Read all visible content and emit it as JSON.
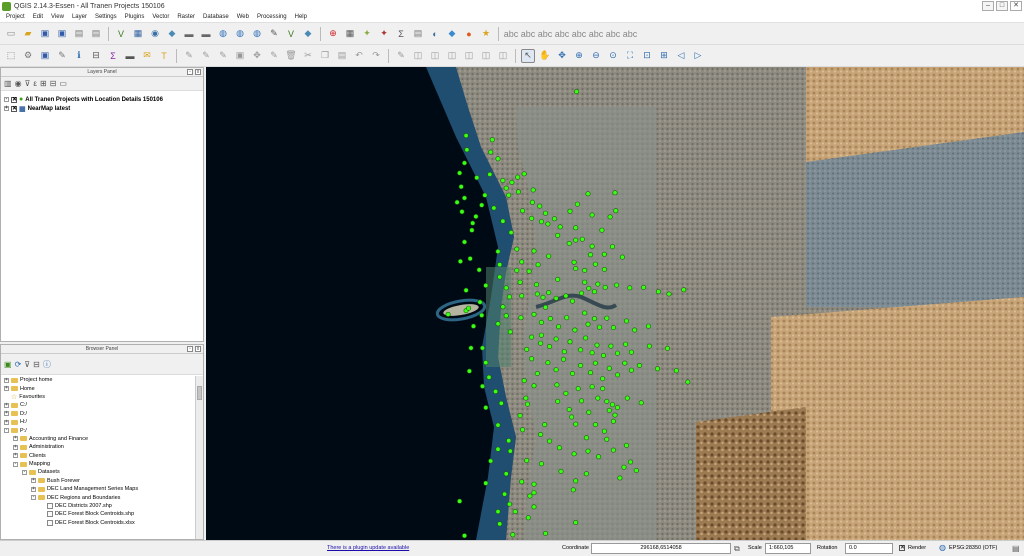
{
  "window": {
    "title": "QGIS 2.14.3-Essen - All Tranen Projects 150106"
  },
  "menu": [
    "Project",
    "Edit",
    "View",
    "Layer",
    "Settings",
    "Plugins",
    "Vector",
    "Raster",
    "Database",
    "Web",
    "Processing",
    "Help"
  ],
  "layers_panel": {
    "title": "Layers Panel",
    "layers": [
      {
        "name": "All Tranen Projects with Location Details 150106",
        "checked": true
      },
      {
        "name": "NearMap latest",
        "checked": true
      }
    ]
  },
  "browser_panel": {
    "title": "Browser Panel",
    "items": [
      {
        "label": "Project home",
        "kind": "folder",
        "depth": 0,
        "expander": "+"
      },
      {
        "label": "Home",
        "kind": "folder",
        "depth": 0,
        "expander": "+"
      },
      {
        "label": "Favourites",
        "kind": "star",
        "depth": 0,
        "expander": ""
      },
      {
        "label": "C:/",
        "kind": "folder",
        "depth": 0,
        "expander": "+"
      },
      {
        "label": "D:/",
        "kind": "folder",
        "depth": 0,
        "expander": "+"
      },
      {
        "label": "H:/",
        "kind": "folder",
        "depth": 0,
        "expander": "+"
      },
      {
        "label": "P:/",
        "kind": "folder",
        "depth": 0,
        "expander": "-"
      },
      {
        "label": "Accounting and Finance",
        "kind": "folder",
        "depth": 1,
        "expander": "+"
      },
      {
        "label": "Administration",
        "kind": "folder",
        "depth": 1,
        "expander": "+"
      },
      {
        "label": "Clients",
        "kind": "folder",
        "depth": 1,
        "expander": "+"
      },
      {
        "label": "Mapping",
        "kind": "folder",
        "depth": 1,
        "expander": "-"
      },
      {
        "label": "Datasets",
        "kind": "folder",
        "depth": 2,
        "expander": "-"
      },
      {
        "label": "Bush Forever",
        "kind": "folder",
        "depth": 3,
        "expander": "+"
      },
      {
        "label": "DEC Land Management Series Maps",
        "kind": "folder",
        "depth": 3,
        "expander": "+"
      },
      {
        "label": "DEC Regions and Boundaries",
        "kind": "folder",
        "depth": 3,
        "expander": "-"
      },
      {
        "label": "DEC Districts 2007.shp",
        "kind": "file",
        "depth": 4,
        "expander": ""
      },
      {
        "label": "DEC Forest Block Centroids.shp",
        "kind": "file",
        "depth": 4,
        "expander": ""
      },
      {
        "label": "DEC Forest Block Centroids.xlsx",
        "kind": "file",
        "depth": 4,
        "expander": ""
      }
    ]
  },
  "status": {
    "update_link": "There is a plugin update available",
    "coordinate_label": "Coordinate",
    "coordinate_value": "296168,6514058",
    "scale_label": "Scale",
    "scale_value": "1:660,105",
    "rotation_label": "Rotation",
    "rotation_value": "0.0",
    "render_label": "Render",
    "crs": "EPSG:28350 (OTF)"
  },
  "colors": {
    "point": "#39ff14",
    "point_outline": "#1a5c0a",
    "sea": "#000a14"
  },
  "map_points": [
    [
      0.453,
      0.052
    ],
    [
      0.35,
      0.154
    ],
    [
      0.348,
      0.18
    ],
    [
      0.357,
      0.194
    ],
    [
      0.363,
      0.24
    ],
    [
      0.367,
      0.256
    ],
    [
      0.37,
      0.271
    ],
    [
      0.374,
      0.244
    ],
    [
      0.381,
      0.233
    ],
    [
      0.389,
      0.226
    ],
    [
      0.382,
      0.264
    ],
    [
      0.399,
      0.286
    ],
    [
      0.408,
      0.294
    ],
    [
      0.415,
      0.309
    ],
    [
      0.41,
      0.327
    ],
    [
      0.418,
      0.332
    ],
    [
      0.426,
      0.321
    ],
    [
      0.433,
      0.338
    ],
    [
      0.43,
      0.356
    ],
    [
      0.444,
      0.373
    ],
    [
      0.452,
      0.366
    ],
    [
      0.46,
      0.364
    ],
    [
      0.484,
      0.345
    ],
    [
      0.472,
      0.379
    ],
    [
      0.47,
      0.397
    ],
    [
      0.476,
      0.417
    ],
    [
      0.43,
      0.449
    ],
    [
      0.404,
      0.46
    ],
    [
      0.405,
      0.48
    ],
    [
      0.412,
      0.487
    ],
    [
      0.419,
      0.477
    ],
    [
      0.428,
      0.489
    ],
    [
      0.44,
      0.484
    ],
    [
      0.448,
      0.495
    ],
    [
      0.459,
      0.478
    ],
    [
      0.463,
      0.455
    ],
    [
      0.468,
      0.468
    ],
    [
      0.479,
      0.459
    ],
    [
      0.475,
      0.475
    ],
    [
      0.488,
      0.466
    ],
    [
      0.502,
      0.461
    ],
    [
      0.518,
      0.467
    ],
    [
      0.535,
      0.466
    ],
    [
      0.553,
      0.475
    ],
    [
      0.566,
      0.48
    ],
    [
      0.584,
      0.471
    ],
    [
      0.415,
      0.508
    ],
    [
      0.401,
      0.523
    ],
    [
      0.41,
      0.54
    ],
    [
      0.421,
      0.532
    ],
    [
      0.431,
      0.549
    ],
    [
      0.441,
      0.53
    ],
    [
      0.451,
      0.556
    ],
    [
      0.463,
      0.52
    ],
    [
      0.467,
      0.544
    ],
    [
      0.475,
      0.532
    ],
    [
      0.481,
      0.55
    ],
    [
      0.49,
      0.531
    ],
    [
      0.498,
      0.551
    ],
    [
      0.514,
      0.537
    ],
    [
      0.524,
      0.556
    ],
    [
      0.541,
      0.548
    ],
    [
      0.398,
      0.571
    ],
    [
      0.409,
      0.584
    ],
    [
      0.42,
      0.591
    ],
    [
      0.428,
      0.575
    ],
    [
      0.438,
      0.602
    ],
    [
      0.445,
      0.581
    ],
    [
      0.458,
      0.598
    ],
    [
      0.464,
      0.573
    ],
    [
      0.472,
      0.604
    ],
    [
      0.478,
      0.588
    ],
    [
      0.486,
      0.61
    ],
    [
      0.495,
      0.59
    ],
    [
      0.503,
      0.605
    ],
    [
      0.513,
      0.586
    ],
    [
      0.52,
      0.603
    ],
    [
      0.542,
      0.59
    ],
    [
      0.564,
      0.595
    ],
    [
      0.418,
      0.625
    ],
    [
      0.428,
      0.64
    ],
    [
      0.437,
      0.618
    ],
    [
      0.448,
      0.648
    ],
    [
      0.458,
      0.631
    ],
    [
      0.47,
      0.646
    ],
    [
      0.476,
      0.626
    ],
    [
      0.485,
      0.659
    ],
    [
      0.493,
      0.637
    ],
    [
      0.503,
      0.651
    ],
    [
      0.52,
      0.641
    ],
    [
      0.512,
      0.626
    ],
    [
      0.53,
      0.631
    ],
    [
      0.552,
      0.638
    ],
    [
      0.575,
      0.642
    ],
    [
      0.589,
      0.666
    ],
    [
      0.429,
      0.672
    ],
    [
      0.44,
      0.69
    ],
    [
      0.455,
      0.68
    ],
    [
      0.472,
      0.676
    ],
    [
      0.479,
      0.7
    ],
    [
      0.49,
      0.707
    ],
    [
      0.497,
      0.714
    ],
    [
      0.493,
      0.726
    ],
    [
      0.503,
      0.72
    ],
    [
      0.5,
      0.736
    ],
    [
      0.498,
      0.749
    ],
    [
      0.515,
      0.7
    ],
    [
      0.532,
      0.71
    ],
    [
      0.444,
      0.724
    ],
    [
      0.447,
      0.74
    ],
    [
      0.414,
      0.756
    ],
    [
      0.409,
      0.777
    ],
    [
      0.42,
      0.791
    ],
    [
      0.432,
      0.805
    ],
    [
      0.45,
      0.818
    ],
    [
      0.467,
      0.812
    ],
    [
      0.48,
      0.824
    ],
    [
      0.514,
      0.8
    ],
    [
      0.511,
      0.846
    ],
    [
      0.526,
      0.853
    ],
    [
      0.506,
      0.869
    ],
    [
      0.519,
      0.835
    ],
    [
      0.498,
      0.81
    ],
    [
      0.41,
      0.839
    ],
    [
      0.401,
      0.882
    ],
    [
      0.378,
      0.94
    ],
    [
      0.401,
      0.93
    ],
    [
      0.357,
      0.94
    ],
    [
      0.359,
      0.966
    ],
    [
      0.415,
      0.986
    ],
    [
      0.452,
      0.963
    ],
    [
      0.509,
      0.402
    ],
    [
      0.45,
      0.413
    ],
    [
      0.452,
      0.426
    ],
    [
      0.494,
      0.317
    ],
    [
      0.501,
      0.304
    ],
    [
      0.387,
      0.304
    ],
    [
      0.357,
      0.39
    ],
    [
      0.359,
      0.444
    ],
    [
      0.318,
      0.515
    ],
    [
      0.357,
      0.543
    ],
    [
      0.4,
      0.26
    ],
    [
      0.398,
      0.32
    ],
    [
      0.352,
      0.298
    ],
    [
      0.326,
      0.33
    ],
    [
      0.318,
      0.472
    ],
    [
      0.321,
      0.51
    ],
    [
      0.327,
      0.548
    ],
    [
      0.324,
      0.594
    ],
    [
      0.322,
      0.643
    ],
    [
      0.338,
      0.675
    ],
    [
      0.361,
      0.711
    ],
    [
      0.452,
      0.875
    ],
    [
      0.449,
      0.894
    ],
    [
      0.465,
      0.86
    ],
    [
      0.434,
      0.855
    ],
    [
      0.401,
      0.9
    ],
    [
      0.392,
      0.832
    ],
    [
      0.393,
      0.713
    ],
    [
      0.401,
      0.674
    ],
    [
      0.405,
      0.648
    ],
    [
      0.398,
      0.617
    ],
    [
      0.392,
      0.597
    ],
    [
      0.312,
      0.253
    ],
    [
      0.316,
      0.277
    ],
    [
      0.31,
      0.224
    ],
    [
      0.316,
      0.203
    ],
    [
      0.319,
      0.175
    ],
    [
      0.318,
      0.145
    ],
    [
      0.331,
      0.234
    ],
    [
      0.347,
      0.227
    ],
    [
      0.341,
      0.271
    ],
    [
      0.337,
      0.292
    ],
    [
      0.33,
      0.316
    ],
    [
      0.325,
      0.345
    ],
    [
      0.316,
      0.37
    ],
    [
      0.323,
      0.405
    ],
    [
      0.311,
      0.411
    ],
    [
      0.334,
      0.429
    ],
    [
      0.342,
      0.462
    ],
    [
      0.335,
      0.497
    ],
    [
      0.337,
      0.525
    ],
    [
      0.338,
      0.594
    ],
    [
      0.342,
      0.625
    ],
    [
      0.346,
      0.656
    ],
    [
      0.354,
      0.686
    ],
    [
      0.342,
      0.72
    ],
    [
      0.357,
      0.757
    ],
    [
      0.37,
      0.79
    ],
    [
      0.372,
      0.812
    ],
    [
      0.367,
      0.86
    ],
    [
      0.386,
      0.877
    ],
    [
      0.396,
      0.907
    ],
    [
      0.394,
      0.953
    ],
    [
      0.375,
      0.989
    ],
    [
      0.31,
      0.918
    ],
    [
      0.316,
      0.991
    ],
    [
      0.357,
      0.808
    ],
    [
      0.348,
      0.833
    ],
    [
      0.342,
      0.88
    ],
    [
      0.365,
      0.903
    ],
    [
      0.371,
      0.924
    ],
    [
      0.387,
      0.767
    ],
    [
      0.384,
      0.737
    ],
    [
      0.391,
      0.7
    ],
    [
      0.389,
      0.663
    ],
    [
      0.372,
      0.56
    ],
    [
      0.367,
      0.526
    ],
    [
      0.363,
      0.507
    ],
    [
      0.371,
      0.486
    ],
    [
      0.367,
      0.467
    ],
    [
      0.384,
      0.455
    ],
    [
      0.38,
      0.43
    ],
    [
      0.359,
      0.418
    ],
    [
      0.363,
      0.326
    ],
    [
      0.373,
      0.35
    ],
    [
      0.38,
      0.385
    ],
    [
      0.313,
      0.306
    ],
    [
      0.307,
      0.286
    ],
    [
      0.452,
      0.34
    ],
    [
      0.467,
      0.268
    ],
    [
      0.5,
      0.266
    ],
    [
      0.472,
      0.313
    ],
    [
      0.454,
      0.29
    ],
    [
      0.445,
      0.305
    ],
    [
      0.487,
      0.396
    ],
    [
      0.487,
      0.428
    ],
    [
      0.463,
      0.43
    ],
    [
      0.497,
      0.38
    ],
    [
      0.419,
      0.4
    ],
    [
      0.401,
      0.389
    ],
    [
      0.406,
      0.418
    ],
    [
      0.395,
      0.432
    ],
    [
      0.386,
      0.412
    ],
    [
      0.386,
      0.484
    ],
    [
      0.385,
      0.53
    ],
    [
      0.41,
      0.567
    ],
    [
      0.43,
      0.707
    ],
    [
      0.452,
      0.755
    ],
    [
      0.465,
      0.784
    ],
    [
      0.476,
      0.756
    ],
    [
      0.487,
      0.77
    ],
    [
      0.49,
      0.787
    ],
    [
      0.468,
      0.73
    ],
    [
      0.459,
      0.706
    ],
    [
      0.485,
      0.68
    ],
    [
      0.296,
      0.523
    ]
  ]
}
